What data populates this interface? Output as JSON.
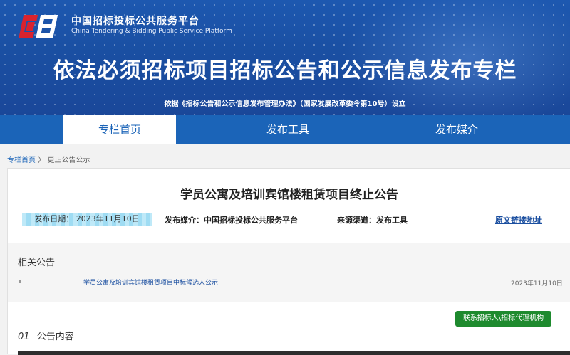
{
  "header": {
    "site_name_cn": "中国招标投标公共服务平台",
    "site_name_en": "China Tendering & Bidding Public Service Platform",
    "main_title": "依法必须招标项目招标公告和公示信息发布专栏",
    "subtitle": "依据《招标公告和公示信息发布管理办法》（国家发展改革委令第10号）设立"
  },
  "nav": {
    "tabs": [
      {
        "label": "专栏首页",
        "active": true
      },
      {
        "label": "发布工具",
        "active": false
      },
      {
        "label": "发布媒介",
        "active": false
      }
    ]
  },
  "breadcrumb": {
    "home": "专栏首页",
    "separator": "〉",
    "current": "更正公告公示"
  },
  "notice": {
    "title": "学员公寓及培训宾馆楼租赁项目终止公告",
    "publish_date": "发布日期： 2023年11月10日",
    "media": "发布媒介：中国招标投标公共服务平台",
    "source": "来源渠道：发布工具",
    "original_link": "原文链接地址"
  },
  "related": {
    "heading": "相关公告",
    "items": [
      {
        "title": "学员公寓及培训宾馆楼租赁项目中标候选人公示",
        "date": "2023年11月10日"
      }
    ]
  },
  "contact_button": "联系招标人\\招标代理机构",
  "section": {
    "number": "01",
    "heading": "公告内容"
  },
  "colors": {
    "brand_blue": "#1b64b8",
    "header_blue": "#1a4fa2",
    "link_blue": "#1b4fa0",
    "button_green": "#1e8a2e",
    "logo_red": "#d9232e"
  }
}
